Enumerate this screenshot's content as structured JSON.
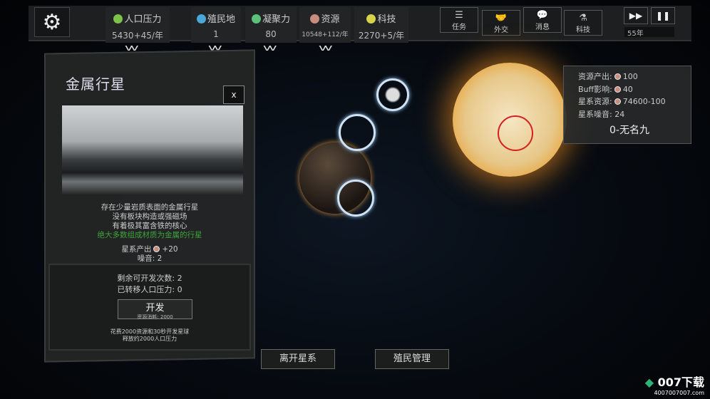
{
  "topbar": {
    "stats": [
      {
        "label": "人口压力",
        "value": "5430+45/年",
        "icon": "population-icon",
        "color": "#7dc24a"
      },
      {
        "label": "殖民地",
        "value": "1",
        "icon": "colony-icon",
        "color": "#4aa7d8"
      },
      {
        "label": "凝聚力",
        "value": "80",
        "icon": "cohesion-icon",
        "color": "#5cc07a"
      },
      {
        "label": "资源",
        "value": "10548+112/年",
        "icon": "resource-icon",
        "color": "#c98d7d"
      },
      {
        "label": "科技",
        "value": "2270+5/年",
        "icon": "tech-icon",
        "color": "#d7d44a"
      }
    ],
    "buttons": [
      {
        "label": "任务",
        "icon": "task-icon"
      },
      {
        "label": "外交",
        "icon": "handshake-icon"
      },
      {
        "label": "消息",
        "icon": "message-icon"
      },
      {
        "label": "科技",
        "icon": "flask-icon"
      }
    ],
    "year": "55年"
  },
  "planet_panel": {
    "title": "金属行星",
    "close": "x",
    "description": [
      "存在少量岩质表面的金属行星",
      "没有板块构造或强磁场",
      "有着极其富含铁的核心"
    ],
    "highlight": "绝大多数组成材质为金属的行星",
    "output_label": "星系产出",
    "output_value": "+20",
    "noise": "噪音: 2",
    "remaining": "剩余可开发次数: 2",
    "transferred": "已转移人口压力: 0",
    "develop_label": "开发",
    "develop_cost": "资源消耗: 2000",
    "note": [
      "花费2000资源和30秒开发星球",
      "释放约2000人口压力"
    ]
  },
  "system_info": {
    "rows": [
      {
        "label": "资源产出:",
        "value": "100",
        "icon": true
      },
      {
        "label": "Buff影响:",
        "value": "40",
        "icon": true
      },
      {
        "label": "星系资源:",
        "value": "74600-100",
        "icon": true
      },
      {
        "label": "星系噪音:",
        "value": "24",
        "icon": false
      }
    ],
    "name": "0-无名九"
  },
  "bottom": {
    "leave": "离开星系",
    "colony": "殖民管理"
  },
  "watermark": "007下载 4007007007.com",
  "colors": {
    "accent_green": "#3fa43a",
    "sun": "#e7c88a",
    "selection_ring": "#d62020"
  }
}
